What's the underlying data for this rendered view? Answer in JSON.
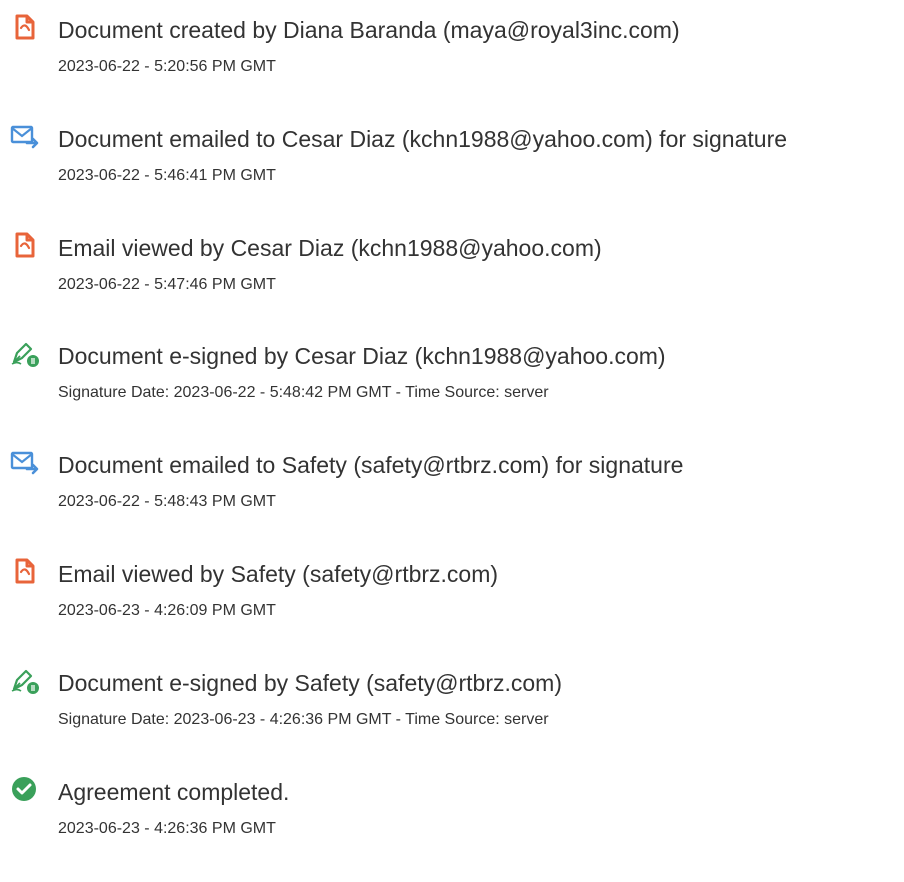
{
  "colors": {
    "text": "#333333",
    "doc_icon": "#e8643a",
    "email_icon": "#4a90d9",
    "sign_icon": "#3aa05a",
    "complete_icon": "#3aa05a"
  },
  "events": [
    {
      "icon": "document-icon",
      "title": "Document created by Diana Baranda (maya@royal3inc.com)",
      "stamp": "2023-06-22 - 5:20:56 PM GMT"
    },
    {
      "icon": "email-sent-icon",
      "title": "Document emailed to Cesar Diaz (kchn1988@yahoo.com) for signature",
      "stamp": "2023-06-22 - 5:46:41 PM GMT"
    },
    {
      "icon": "document-icon",
      "title": "Email viewed by Cesar Diaz (kchn1988@yahoo.com)",
      "stamp": "2023-06-22 - 5:47:46 PM GMT"
    },
    {
      "icon": "esign-pen-icon",
      "title": "Document e-signed by Cesar Diaz (kchn1988@yahoo.com)",
      "stamp": "Signature Date: 2023-06-22 - 5:48:42 PM GMT - Time Source: server"
    },
    {
      "icon": "email-sent-icon",
      "title": "Document emailed to Safety (safety@rtbrz.com) for signature",
      "stamp": "2023-06-22 - 5:48:43 PM GMT"
    },
    {
      "icon": "document-icon",
      "title": "Email viewed by Safety (safety@rtbrz.com)",
      "stamp": "2023-06-23 - 4:26:09 PM GMT"
    },
    {
      "icon": "esign-pen-icon",
      "title": "Document e-signed by Safety (safety@rtbrz.com)",
      "stamp": "Signature Date: 2023-06-23 - 4:26:36 PM GMT - Time Source: server"
    },
    {
      "icon": "checkmark-circle-icon",
      "title": "Agreement completed.",
      "stamp": "2023-06-23 - 4:26:36 PM GMT"
    }
  ]
}
